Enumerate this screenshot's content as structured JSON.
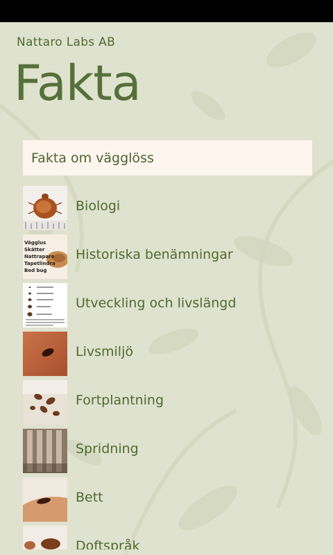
{
  "app": {
    "publisher": "Nattaro Labs AB",
    "title": "Fakta"
  },
  "section_header": "Fakta om vägglöss",
  "items": [
    {
      "label": "Biologi",
      "icon": "bedbug-on-ruler-photo"
    },
    {
      "label": "Historiska benämningar",
      "icon": "bedbug-names-thumbnail",
      "thumb_text": [
        "Vägglus",
        "Skätter",
        "Nattrapare",
        "Tapetlindra",
        "Bed bug"
      ]
    },
    {
      "label": "Utveckling och livslängd",
      "icon": "lifecycle-stages-thumbnail"
    },
    {
      "label": "Livsmiljö",
      "icon": "bedbug-on-skin-photo"
    },
    {
      "label": "Fortplantning",
      "icon": "bedbug-cluster-photo"
    },
    {
      "label": "Spridning",
      "icon": "mattress-photo"
    },
    {
      "label": "Bett",
      "icon": "bedbug-on-arm-photo"
    },
    {
      "label": "Doftspråk",
      "icon": "bedbug-photo"
    }
  ],
  "colors": {
    "accent": "#56703a",
    "header_box": "#fdf5ee",
    "statusbar": "#000000"
  }
}
